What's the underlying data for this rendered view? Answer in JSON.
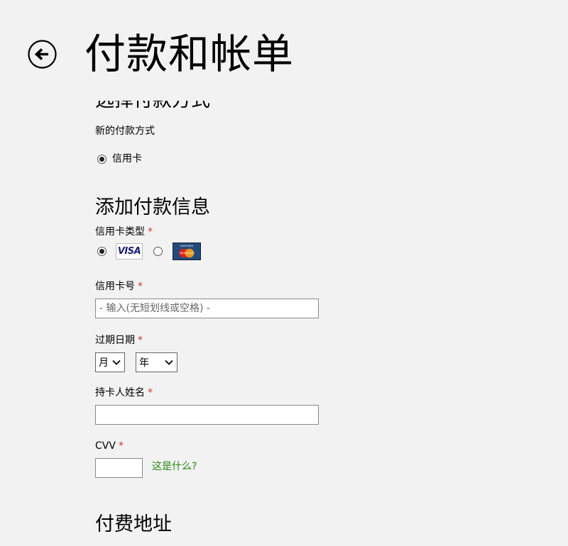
{
  "header": {
    "title": "付款和帐单"
  },
  "payment_method": {
    "heading": "选择付款方式",
    "new_method_label": "新的付款方式",
    "option_credit_card": "信用卡"
  },
  "add_payment": {
    "heading": "添加付款信息",
    "card_type_label": "信用卡类型",
    "required_mark": "*",
    "card_number_label": "信用卡号",
    "card_number_placeholder": "- 输入(无短划线或空格) -",
    "expiry_label": "过期日期",
    "month_value": "月",
    "year_value": "年",
    "holder_name_label": "持卡人姓名",
    "cvv_label": "CVV",
    "cvv_help_link": "这是什么?"
  },
  "logos": {
    "visa_text": "VISA",
    "mastercard_text": "MasterCard",
    "eurocard_text": "EUROCARD"
  },
  "next_section": {
    "heading": "付费地址"
  },
  "colors": {
    "background": "#f2f2f2",
    "required": "#c8382a",
    "link": "#2a8a14"
  }
}
